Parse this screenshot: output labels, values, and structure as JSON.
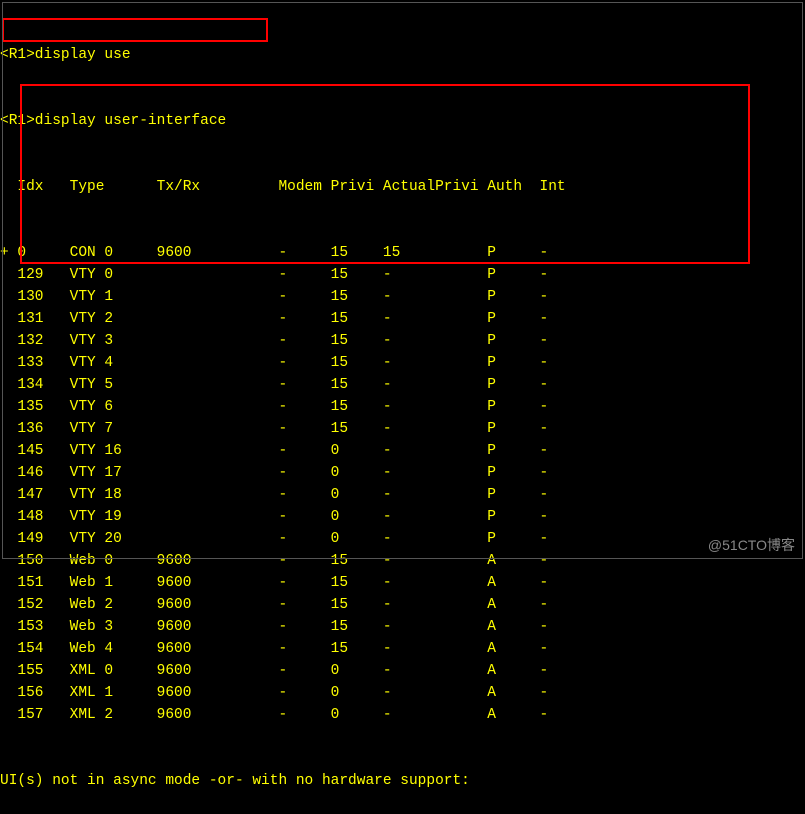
{
  "prompt_line1": "<R1>display use",
  "prompt_line2": "<R1>display user-interface",
  "header": {
    "idx": "Idx",
    "type": "Type",
    "txrx": "Tx/Rx",
    "modem": "Modem",
    "privi": "Privi",
    "actualprivi": "ActualPrivi",
    "auth": "Auth",
    "int": "Int"
  },
  "rows": [
    {
      "mark": "+",
      "idx": "0",
      "type": "CON 0",
      "txrx": "9600",
      "modem": "-",
      "privi": "15",
      "ap": "15",
      "auth": "P",
      "int": "-"
    },
    {
      "mark": " ",
      "idx": "129",
      "type": "VTY 0",
      "txrx": "",
      "modem": "-",
      "privi": "15",
      "ap": "-",
      "auth": "P",
      "int": "-"
    },
    {
      "mark": " ",
      "idx": "130",
      "type": "VTY 1",
      "txrx": "",
      "modem": "-",
      "privi": "15",
      "ap": "-",
      "auth": "P",
      "int": "-"
    },
    {
      "mark": " ",
      "idx": "131",
      "type": "VTY 2",
      "txrx": "",
      "modem": "-",
      "privi": "15",
      "ap": "-",
      "auth": "P",
      "int": "-"
    },
    {
      "mark": " ",
      "idx": "132",
      "type": "VTY 3",
      "txrx": "",
      "modem": "-",
      "privi": "15",
      "ap": "-",
      "auth": "P",
      "int": "-"
    },
    {
      "mark": " ",
      "idx": "133",
      "type": "VTY 4",
      "txrx": "",
      "modem": "-",
      "privi": "15",
      "ap": "-",
      "auth": "P",
      "int": "-"
    },
    {
      "mark": " ",
      "idx": "134",
      "type": "VTY 5",
      "txrx": "",
      "modem": "-",
      "privi": "15",
      "ap": "-",
      "auth": "P",
      "int": "-"
    },
    {
      "mark": " ",
      "idx": "135",
      "type": "VTY 6",
      "txrx": "",
      "modem": "-",
      "privi": "15",
      "ap": "-",
      "auth": "P",
      "int": "-"
    },
    {
      "mark": " ",
      "idx": "136",
      "type": "VTY 7",
      "txrx": "",
      "modem": "-",
      "privi": "15",
      "ap": "-",
      "auth": "P",
      "int": "-"
    },
    {
      "mark": " ",
      "idx": "145",
      "type": "VTY 16",
      "txrx": "",
      "modem": "-",
      "privi": "0",
      "ap": "-",
      "auth": "P",
      "int": "-"
    },
    {
      "mark": " ",
      "idx": "146",
      "type": "VTY 17",
      "txrx": "",
      "modem": "-",
      "privi": "0",
      "ap": "-",
      "auth": "P",
      "int": "-"
    },
    {
      "mark": " ",
      "idx": "147",
      "type": "VTY 18",
      "txrx": "",
      "modem": "-",
      "privi": "0",
      "ap": "-",
      "auth": "P",
      "int": "-"
    },
    {
      "mark": " ",
      "idx": "148",
      "type": "VTY 19",
      "txrx": "",
      "modem": "-",
      "privi": "0",
      "ap": "-",
      "auth": "P",
      "int": "-"
    },
    {
      "mark": " ",
      "idx": "149",
      "type": "VTY 20",
      "txrx": "",
      "modem": "-",
      "privi": "0",
      "ap": "-",
      "auth": "P",
      "int": "-"
    },
    {
      "mark": " ",
      "idx": "150",
      "type": "Web 0",
      "txrx": "9600",
      "modem": "-",
      "privi": "15",
      "ap": "-",
      "auth": "A",
      "int": "-"
    },
    {
      "mark": " ",
      "idx": "151",
      "type": "Web 1",
      "txrx": "9600",
      "modem": "-",
      "privi": "15",
      "ap": "-",
      "auth": "A",
      "int": "-"
    },
    {
      "mark": " ",
      "idx": "152",
      "type": "Web 2",
      "txrx": "9600",
      "modem": "-",
      "privi": "15",
      "ap": "-",
      "auth": "A",
      "int": "-"
    },
    {
      "mark": " ",
      "idx": "153",
      "type": "Web 3",
      "txrx": "9600",
      "modem": "-",
      "privi": "15",
      "ap": "-",
      "auth": "A",
      "int": "-"
    },
    {
      "mark": " ",
      "idx": "154",
      "type": "Web 4",
      "txrx": "9600",
      "modem": "-",
      "privi": "15",
      "ap": "-",
      "auth": "A",
      "int": "-"
    },
    {
      "mark": " ",
      "idx": "155",
      "type": "XML 0",
      "txrx": "9600",
      "modem": "-",
      "privi": "0",
      "ap": "-",
      "auth": "A",
      "int": "-"
    },
    {
      "mark": " ",
      "idx": "156",
      "type": "XML 1",
      "txrx": "9600",
      "modem": "-",
      "privi": "0",
      "ap": "-",
      "auth": "A",
      "int": "-"
    },
    {
      "mark": " ",
      "idx": "157",
      "type": "XML 2",
      "txrx": "9600",
      "modem": "-",
      "privi": "0",
      "ap": "-",
      "auth": "A",
      "int": "-"
    }
  ],
  "footer": "UI(s) not in async mode -or- with no hardware support:",
  "watermark": "@51CTO博客"
}
